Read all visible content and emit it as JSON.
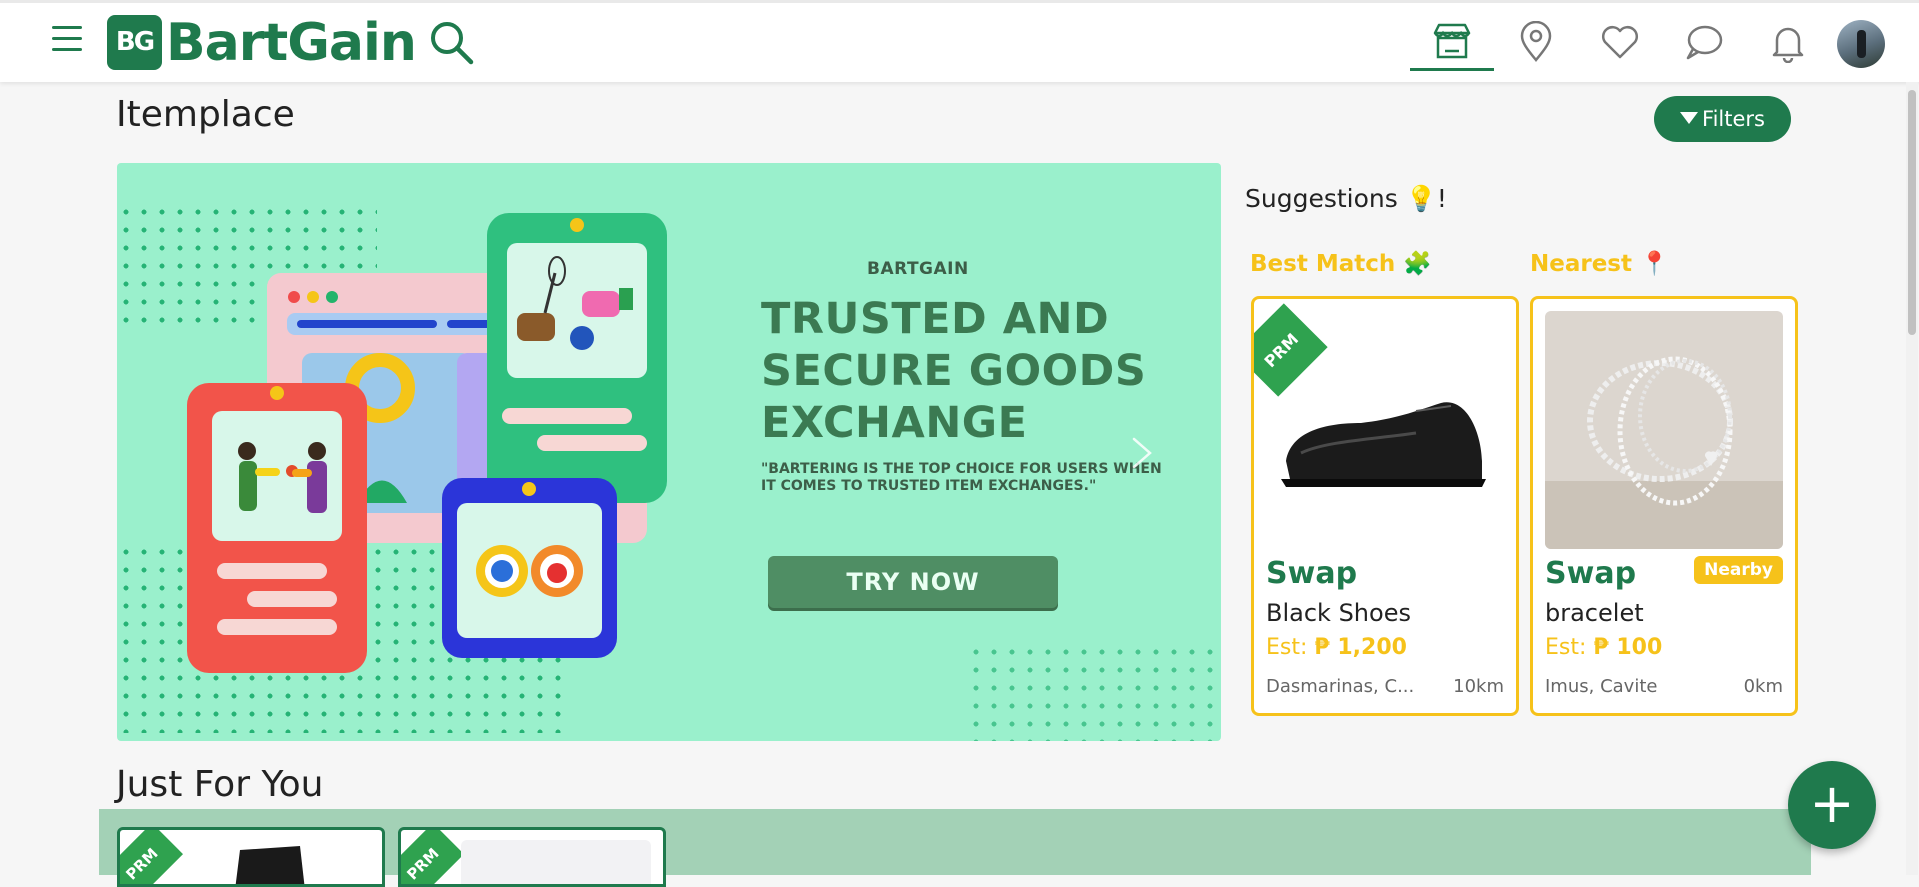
{
  "app": {
    "logo_mark": "BG",
    "logo_text": "BartGain"
  },
  "header": {
    "icons": [
      "menu-icon",
      "search-icon",
      "store-icon",
      "location-pin-icon",
      "heart-icon",
      "chat-icon",
      "bell-icon"
    ],
    "active_nav": "store-icon"
  },
  "page": {
    "title": "Itemplace",
    "filters_label": "Filters"
  },
  "banner": {
    "eyebrow": "BARTGAIN",
    "headline": "TRUSTED AND SECURE GOODS EXCHANGE",
    "quote": "\"BARTERING IS THE TOP CHOICE FOR USERS WHEN IT COMES TO TRUSTED ITEM EXCHANGES.\"",
    "cta": "TRY NOW"
  },
  "suggestions": {
    "title": "Suggestions 💡!",
    "best_match_label": "Best Match 🧩",
    "nearest_label": "Nearest 📍",
    "cards": [
      {
        "ribbon": "PRM",
        "type": "Swap",
        "name": "Black Shoes",
        "price_prefix": "Est:",
        "price": "₱ 1,200",
        "location": "Dasmarinas, C...",
        "distance": "10km"
      },
      {
        "badge": "Nearby",
        "type": "Swap",
        "name": "bracelet",
        "price_prefix": "Est:",
        "price": "₱ 100",
        "location": "Imus, Cavite",
        "distance": "0km"
      }
    ]
  },
  "just_for_you": {
    "title": "Just For You",
    "ribbon": "PRM"
  },
  "fab": {
    "label": "+"
  },
  "colors": {
    "brand": "#1f7a4d",
    "accent": "#f6c21a",
    "banner_bg": "#9af0cc"
  }
}
